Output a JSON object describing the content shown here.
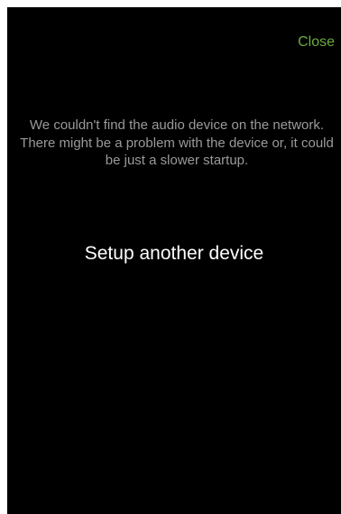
{
  "header": {
    "close_label": "Close"
  },
  "main": {
    "message": "We couldn't find the audio device on the network. There might be a problem with the device or, it could be just a slower startup.",
    "setup_label": "Setup another device"
  },
  "colors": {
    "background": "#000000",
    "accent": "#6aad3c",
    "message_text": "#9a9a9a",
    "primary_text": "#ffffff"
  }
}
